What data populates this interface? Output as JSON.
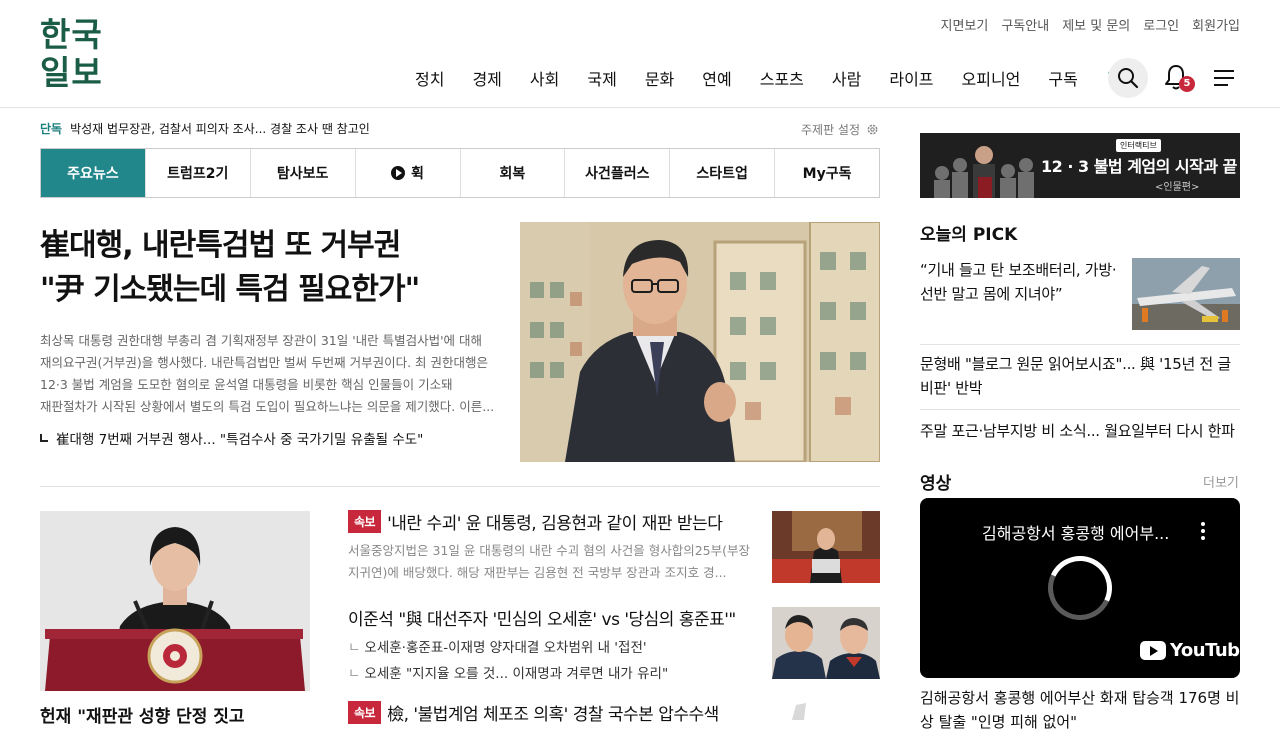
{
  "header": {
    "logo_line1": "한국",
    "logo_line2": "일보",
    "util_links": [
      "지면보기",
      "구독안내",
      "제보 및 문의",
      "로그인",
      "회원가입"
    ],
    "nav": [
      "정치",
      "경제",
      "사회",
      "국제",
      "문화",
      "연예",
      "스포츠",
      "사람",
      "라이프",
      "오피니언"
    ],
    "subscribe_label": "구독",
    "subscribe_plus": "+",
    "notification_count": "5",
    "accent_color": "#1a5c46",
    "icons": [
      "search-icon",
      "bell-icon",
      "hamburger-menu-icon"
    ]
  },
  "breaking": {
    "tag": "단독",
    "headline": "박성재 법무장관, 검찰서 피의자 조사... 경찰 조사 땐 참고인",
    "topic_setting": "주제판 설정"
  },
  "tabs": [
    {
      "label": "주요뉴스",
      "active": true
    },
    {
      "label": "트럼프2기"
    },
    {
      "label": "탐사보도"
    },
    {
      "label": "휙",
      "icon": "play-icon"
    },
    {
      "label": "회복"
    },
    {
      "label": "사건플러스"
    },
    {
      "label": "스타트업"
    },
    {
      "label": "My구독"
    }
  ],
  "lead": {
    "title_line1": "崔대행, 내란특검법 또 거부권",
    "title_line2": "\"尹 기소됐는데 특검 필요한가\"",
    "body": "최상목 대통령 권한대행 부총리 겸 기획재정부 장관이 31일 '내란 특별검사법'에 대해 재의요구권(거부권)을 행사했다. 내란특검법만 벌써 두번째 거부권이다. 최 권한대행은 12·3 불법 계엄을 도모한 혐의로 윤석열 대통령을 비롯한 핵심 인물들이 기소돼 재판절차가 시작된 상황에서 별도의 특검 도입이 필요하느냐는 의문을 제기했다. 이른...",
    "related": "崔대행 7번째 거부권 행사... \"특검수사 중 국가기밀 유출될 수도\""
  },
  "lower": {
    "left_caption": "헌재 \"재판관 성향 단정 짓고",
    "items": [
      {
        "badge": "속보",
        "title": "'내란 수괴' 윤 대통령, 김용현과 같이 재판 받는다",
        "summary": "서울중앙지법은 31일 윤 대통령의 내란 수괴 혐의 사건을 형사합의25부(부장 지귀연)에 배당했다. 해당 재판부는 김용현 전 국방부 장관과 조지호 경..."
      },
      {
        "title": "이준석 \"與 대선주자 '민심의 오세훈' vs '당심의 홍준표'\"",
        "subs": [
          "오세훈·홍준표-이재명 양자대결 오차범위 내 '접전'",
          "오세훈 \"지지율 오를 것... 이재명과 겨루면 내가 유리\""
        ]
      },
      {
        "badge": "속보",
        "title": "檢, '불법계엄 체포조 의혹' 경찰 국수본 압수수색"
      }
    ]
  },
  "right": {
    "banner_tag": "인터랙티브",
    "banner_title": "12 · 3 불법 계엄의 시작과 끝",
    "banner_sub": "<인물편>",
    "pick_heading": "오늘의 PICK",
    "picks": [
      "“기내 들고 탄 보조배터리, 가방·선반 말고 몸에 지녀야”",
      "문형배 \"블로그 원문 읽어보시죠\"... 與 '15년 전 글 비판' 반박",
      "주말 포근·남부지방 비 소식... 월요일부터 다시 한파"
    ],
    "video_heading": "영상",
    "video_more": "더보기",
    "video_title": "김해공항서 홍콩행 에어부...",
    "video_brand": "YouTube",
    "video_caption": "김해공항서 홍콩행 에어부산 화재 탑승객 176명 비상 탈출 \"인명 피해 없어\""
  }
}
